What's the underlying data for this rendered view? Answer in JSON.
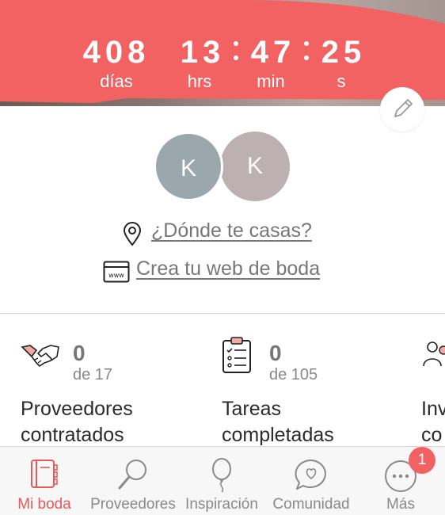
{
  "countdown": {
    "days": {
      "value": "408",
      "unit": "días"
    },
    "hours": {
      "value": "13",
      "unit": "hrs"
    },
    "minutes": {
      "value": "47",
      "unit": "min"
    },
    "seconds": {
      "value": "25",
      "unit": "s"
    }
  },
  "couple": {
    "initial_a": "K",
    "initial_b": "K"
  },
  "links": {
    "where": "¿Dónde te casas?",
    "web": "Crea tu web de boda"
  },
  "stats": [
    {
      "count": "0",
      "total": "de 17",
      "label_line1": "Proveedores",
      "label_line2": "contratados",
      "icon": "handshake-icon"
    },
    {
      "count": "0",
      "total": "de 105",
      "label_line1": "Tareas",
      "label_line2": "completadas",
      "icon": "checklist-icon"
    },
    {
      "count": "",
      "total": "",
      "label_line1": "Inv",
      "label_line2": "co",
      "icon": "guests-icon"
    }
  ],
  "tabs": [
    {
      "label": "Mi boda",
      "icon": "planner-icon",
      "active": true
    },
    {
      "label": "Proveedores",
      "icon": "search-icon",
      "active": false
    },
    {
      "label": "Inspiración",
      "icon": "balloon-icon",
      "active": false
    },
    {
      "label": "Comunidad",
      "icon": "chat-heart-icon",
      "active": false
    },
    {
      "label": "Más",
      "icon": "more-icon",
      "active": false
    }
  ],
  "more_badge": "1",
  "colors": {
    "accent": "#f26263",
    "tab_active": "#e85a5a",
    "avatar_a": "#9aa8ae",
    "avatar_b": "#bdb0b3"
  }
}
